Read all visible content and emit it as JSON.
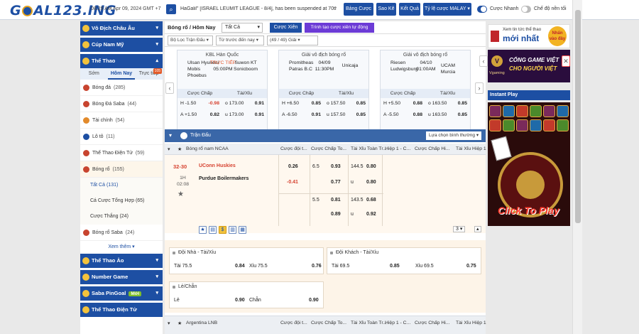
{
  "header": {
    "logo": "GOAL123.ING",
    "datetime": "08:29 AM Apr 09, 2024 GMT +7",
    "ticker": "HaGalil\" [ISRAEL LEUMIT LEAGUE - 8/4], has been suspended at 70th",
    "buttons": [
      "Bảng Cược",
      "Sao Kê",
      "Kết Quả",
      "Tỷ lệ cược MALAY ▾"
    ],
    "toggle_fast": "Cược Nhanh",
    "toggle_bg": "Chế độ nền tối"
  },
  "sidebar": {
    "headers": {
      "euro": "Vô Địch Châu Âu",
      "copa": "Cúp Nam Mỹ",
      "sports": "Thể Thao"
    },
    "tabs": [
      "Sớm",
      "Hôm Nay",
      "Trực tiếp"
    ],
    "live_count": "105",
    "items": [
      {
        "label": "Bóng đá",
        "count": "(285)"
      },
      {
        "label": "Bóng Đá Saba",
        "count": "(44)"
      },
      {
        "label": "Tài chính",
        "count": "(54)"
      },
      {
        "label": "Lô tô",
        "count": "(11)"
      },
      {
        "label": "Thể Thao Điện Tử",
        "count": "(59)"
      },
      {
        "label": "Bóng rổ",
        "count": "(155)"
      }
    ],
    "sub_items": [
      {
        "label": "Tất Cả",
        "count": "(131)"
      },
      {
        "label": "Cá Cược Tổng Hợp",
        "count": "(65)"
      },
      {
        "label": "Cược Thắng",
        "count": "(24)"
      }
    ],
    "saba_basket": {
      "label": "Bóng rổ Saba",
      "count": "(24)"
    },
    "more": "Xem thêm ▾",
    "virtual": "Thể Thao Ảo",
    "number_game": "Number Game",
    "saba_pingoal": "Saba PinGoal",
    "saba_badge": "Mới",
    "cut": "Thể Thao Điện Tử"
  },
  "main": {
    "title": "Bóng rổ / Hôm Nay",
    "filter": "Tất Cả",
    "btn_parlay": "Cược Xiên",
    "btn_auto": "Trình tạo cược xiên tự động",
    "filter_match": "Bộ Lọc Trận Đấu",
    "filter_time": "Từ trước đến nay",
    "filter_count": "(49 / 49) Giải",
    "cards": [
      {
        "league": "KBL Hàn Quốc",
        "home": "Ulsan Hyundai Mobis Phoebus",
        "mid_live": "TRỰC TIẾP",
        "mid_time": "05:00PM",
        "away": "Suwon KT Sonicboom",
        "hdr": [
          "Cược Chấp",
          "Tài/Xỉu"
        ],
        "rows": [
          [
            "H -1.50",
            "-0.98",
            "o 173.00",
            "0.91"
          ],
          [
            "A +1.50",
            "0.82",
            "u 173.00",
            "0.91"
          ]
        ]
      },
      {
        "league": "Giải vô địch bóng rổ",
        "home": "Promitheas Patras B.C",
        "mid_live": "04/09",
        "mid_time": "11:30PM",
        "away": "Unicaja",
        "hdr": [
          "Cược Chấp",
          "Tài/Xỉu"
        ],
        "rows": [
          [
            "H +6.50",
            "0.85",
            "o 157.50",
            "0.85"
          ],
          [
            "A -6.50",
            "0.91",
            "u 157.50",
            "0.85"
          ]
        ]
      },
      {
        "league": "Giải vô địch bóng rổ",
        "home": "Riesen Ludwigsburg",
        "mid_live": "04/10",
        "mid_time": "01:00AM",
        "away": "UCAM Murcia",
        "hdr": [
          "Cược Chấp",
          "Tài/Xỉu"
        ],
        "rows": [
          [
            "H +5.50",
            "0.88",
            "o 163.50",
            "0.85"
          ],
          [
            "A -5.50",
            "0.88",
            "u 163.50",
            "0.85"
          ]
        ]
      }
    ],
    "section_title": "Trận Đấu",
    "sort_label": "Lựa chọn bình thường ▾",
    "league1": "Bóng rổ nam NCAA",
    "cols": [
      "Cược đội t...",
      "Cược Chấp To...",
      "Tài Xỉu Toàn Tr...",
      "Hiệp 1 - C...",
      "Cược Chấp Hi...",
      "Tài Xỉu Hiệp 1"
    ],
    "match": {
      "score": "32-30",
      "half": "1H",
      "clock": "02:08",
      "home": "UConn Huskies",
      "away": "Purdue Boilermakers",
      "r1": [
        "0.26",
        "6.5",
        "0.93",
        "144.5",
        "0.80"
      ],
      "r2": [
        "-0.41",
        "0.77",
        "u",
        "0.80"
      ],
      "r3": [
        "5.5",
        "0.81",
        "143.5",
        "0.68"
      ],
      "r4": [
        "0.89",
        "u",
        "0.92"
      ]
    },
    "page_select": "3 ▾",
    "detail": {
      "home_ou": {
        "title": "Đội Nhà - Tài/Xỉu",
        "o_label": "Tài 75.5",
        "o_val": "0.84",
        "u_label": "Xỉu 75.5",
        "u_val": "0.76"
      },
      "away_ou": {
        "title": "Đội Khách - Tài/Xỉu",
        "o_label": "Tài 69.5",
        "o_val": "0.85",
        "u_label": "Xỉu 69.5",
        "u_val": "0.75"
      },
      "oddeven": {
        "title": "Lẻ/Chẵn",
        "o_label": "Lẻ",
        "o_val": "0.90",
        "e_label": "Chẵn",
        "e_val": "0.90"
      }
    },
    "league2": "Argentina LNB"
  },
  "right": {
    "banner1_a": "Xem tin tức thể thao",
    "banner1_b": "mới nhất",
    "banner1_c": "Nhấn vào đây",
    "banner2_logo_text": "Vgaming",
    "banner2_t1": "CỔNG GAME VIỆT",
    "banner2_t2": "CHO NGƯỜI VIỆT",
    "instant": "Instant Play",
    "click_to_play": "Click To Play"
  }
}
